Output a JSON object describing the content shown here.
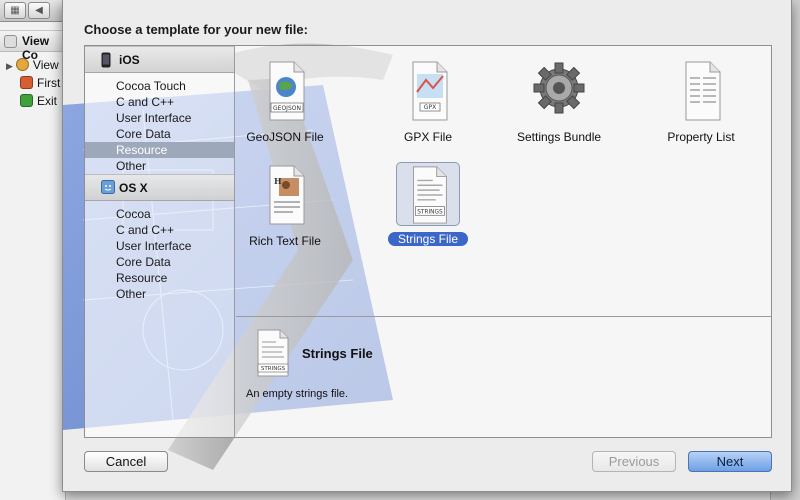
{
  "background": {
    "outline_header": "View Co",
    "rows": [
      {
        "label": "View",
        "icon": "view-controller-icon",
        "color": "#e3a73b"
      },
      {
        "label": "First",
        "icon": "first-responder-icon",
        "color": "#d55e33"
      },
      {
        "label": "Exit",
        "icon": "exit-icon",
        "color": "#3fa03c"
      }
    ]
  },
  "dialog": {
    "title": "Choose a template for your new file:",
    "platforms": [
      {
        "name": "iOS",
        "icon": "iphone-icon",
        "categories": [
          "Cocoa Touch",
          "C and C++",
          "User Interface",
          "Core Data",
          "Resource",
          "Other"
        ],
        "selected": "Resource"
      },
      {
        "name": "OS X",
        "icon": "mac-icon",
        "categories": [
          "Cocoa",
          "C and C++",
          "User Interface",
          "Core Data",
          "Resource",
          "Other"
        ],
        "selected": ""
      }
    ],
    "templates": [
      {
        "label": "GeoJSON File",
        "icon": "geojson-file-icon",
        "badge": "GEOJSON"
      },
      {
        "label": "GPX File",
        "icon": "gpx-file-icon",
        "badge": "GPX"
      },
      {
        "label": "Settings Bundle",
        "icon": "gear-icon",
        "badge": ""
      },
      {
        "label": "Property List",
        "icon": "property-list-icon",
        "badge": ""
      },
      {
        "label": "Rich Text File",
        "icon": "rich-text-file-icon",
        "badge": ""
      },
      {
        "label": "Strings File",
        "icon": "strings-file-icon",
        "badge": "STRINGS"
      }
    ],
    "selected_template": "Strings File",
    "detail": {
      "title": "Strings File",
      "description": "An empty strings file.",
      "badge": "STRINGS"
    },
    "buttons": {
      "cancel": "Cancel",
      "previous": "Previous",
      "next": "Next"
    }
  },
  "colors": {
    "selection_blue": "#3b67c9",
    "category_selection": "#9aa4b7",
    "blueprint": "#6f8fd8"
  }
}
